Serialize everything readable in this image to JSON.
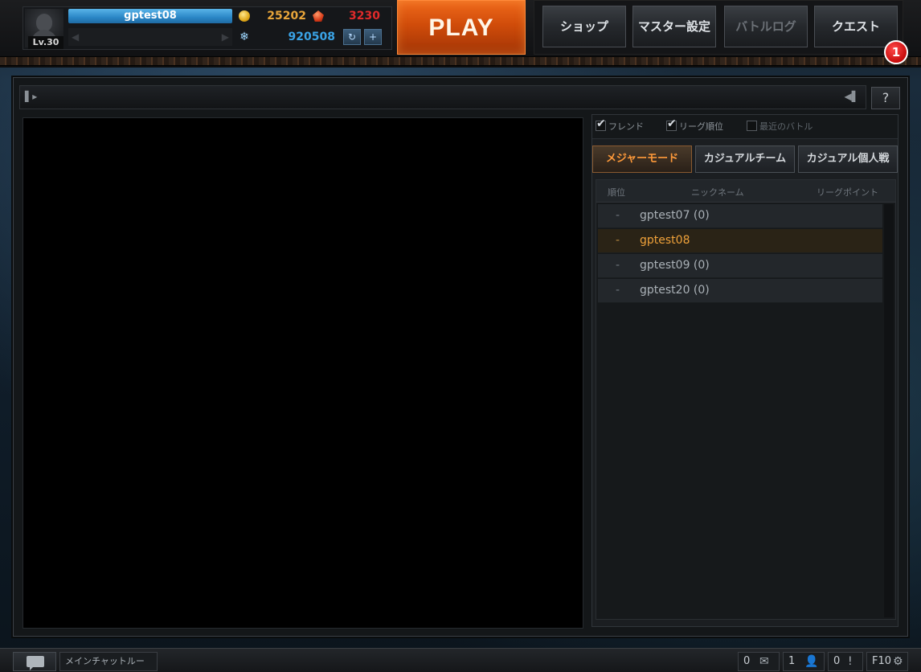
{
  "player": {
    "name": "gptest08",
    "level": "Lv.30",
    "gold": "25202",
    "ruby": "3230",
    "crystal": "920508"
  },
  "play_label": "PLAY",
  "nav": {
    "shop": "ショップ",
    "master": "マスター設定",
    "battlelog": "バトルログ",
    "quest": "クエスト",
    "quest_badge": "1"
  },
  "help_label": "?",
  "filters": {
    "friend": "フレンド",
    "league": "リーグ順位",
    "recent": "最近のバトル"
  },
  "mode_tabs": {
    "major": "メジャーモード",
    "casual_team": "カジュアルチーム",
    "casual_solo": "カジュアル個人戦"
  },
  "table": {
    "headers": {
      "rank": "順位",
      "nickname": "ニックネーム",
      "points": "リーグポイント"
    },
    "rows": [
      {
        "rank": "-",
        "nick": "gptest07 (0)"
      },
      {
        "rank": "-",
        "nick": "gptest08"
      },
      {
        "rank": "-",
        "nick": "gptest09 (0)"
      },
      {
        "rank": "-",
        "nick": "gptest20 (0)"
      }
    ]
  },
  "bottom": {
    "chat_room": "メインチャットルー",
    "mail_count": "0",
    "friend_count": "1",
    "alert_count": "0",
    "settings_key": "F10"
  },
  "colors": {
    "play": "#e25a12",
    "gold": "#e8a53a",
    "ruby": "#e02a2a",
    "crystal": "#3aa3e6",
    "active_tab": "#ff9a3a",
    "namebar": "#2a86c6"
  }
}
